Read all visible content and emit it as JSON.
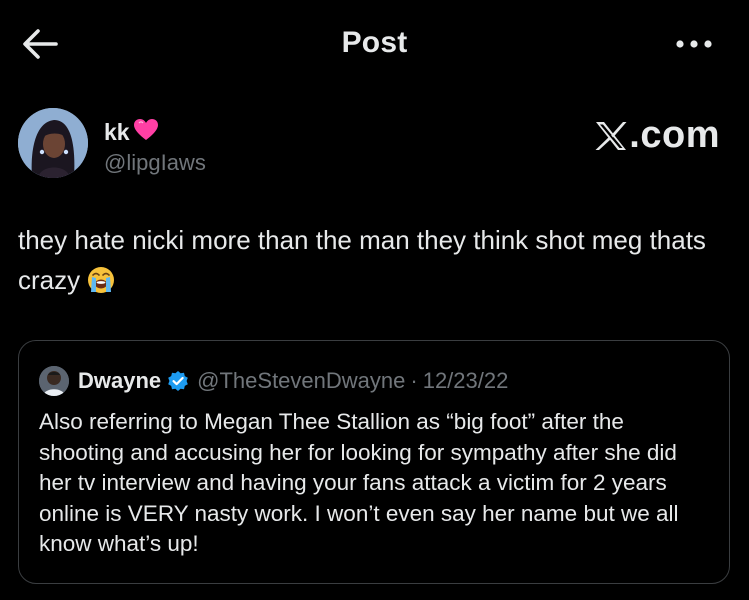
{
  "header": {
    "title": "Post",
    "back_icon": "arrow-left-icon",
    "more_icon": "more-horizontal-icon"
  },
  "author": {
    "display_name": "kk",
    "name_emoji": "pink-heart-icon",
    "handle": "@lipgIaws",
    "avatar": "avatar-image"
  },
  "brand": {
    "logo": "x-logo-icon",
    "text": ".com"
  },
  "post": {
    "text": "they hate nicki more than the man they think shot meg thats crazy",
    "emoji": "loudly-crying-face-icon"
  },
  "quote": {
    "display_name": "Dwayne",
    "verified_icon": "verified-badge-icon",
    "handle": "@TheStevenDwayne",
    "separator": "·",
    "date": "12/23/22",
    "text": "Also referring to Megan Thee Stallion as “big foot” after the shooting and accusing her for looking for sympathy after she did her tv interview and having your fans attack a victim for 2 years online is VERY nasty work. I won’t even say her name but we all know what’s up!"
  },
  "colors": {
    "background": "#000000",
    "text_primary": "#e7e9ea",
    "text_secondary": "#71767b",
    "border": "#3a3d40",
    "verified_blue": "#1d9bf0",
    "heart_pink": "#ff3fa4"
  }
}
